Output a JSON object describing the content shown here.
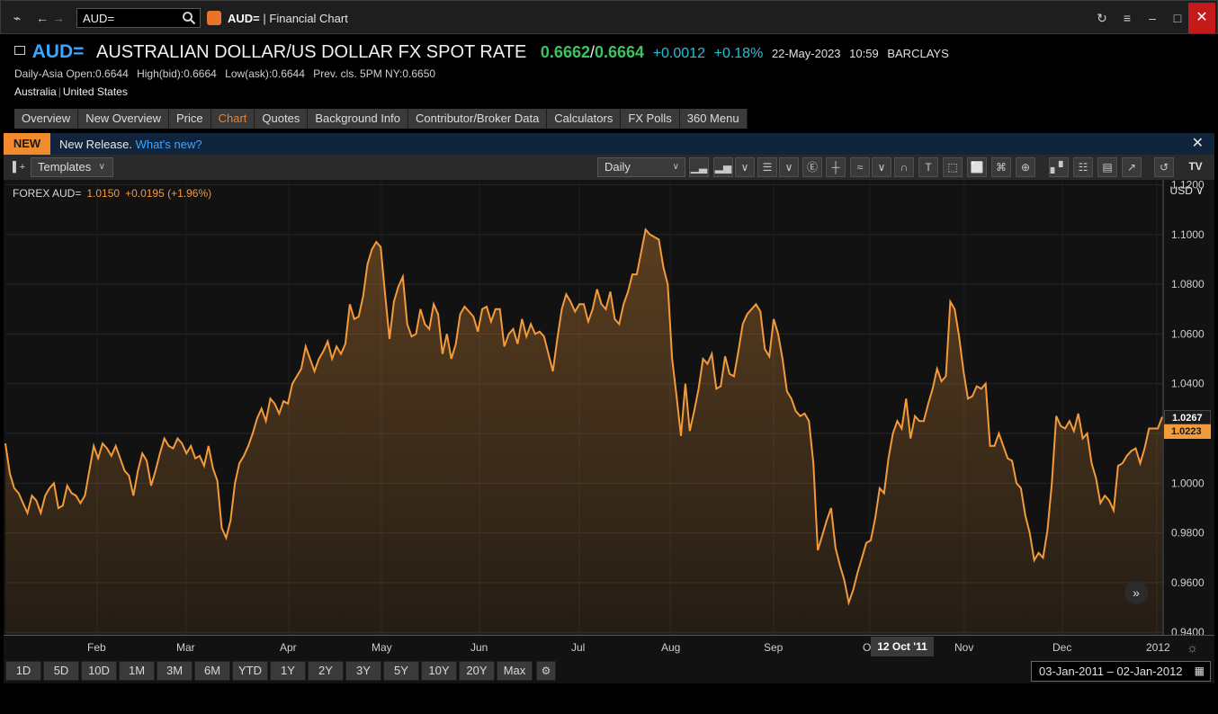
{
  "app": {
    "search_value": "AUD=",
    "title_ric": "AUD=",
    "title_sep": "|",
    "title_app": "Financial Chart"
  },
  "quote": {
    "ric": "AUD=",
    "name": "AUSTRALIAN DOLLAR/US DOLLAR FX SPOT RATE",
    "bid": "0.6662",
    "ask": "0.6664",
    "change": "+0.0012",
    "pct_change": "+0.18%",
    "date": "22-May-2023",
    "time": "10:59",
    "contributor": "BARCLAYS",
    "stats": {
      "open": "Daily-Asia Open:0.6644",
      "high": "High(bid):0.6664",
      "low": "Low(ask):0.6644",
      "prev": "Prev. cls. 5PM NY:0.6650"
    },
    "country_1": "Australia",
    "country_2": "United States"
  },
  "tabs": [
    "Overview",
    "New Overview",
    "Price",
    "Chart",
    "Quotes",
    "Background Info",
    "Contributor/Broker Data",
    "Calculators",
    "FX Polls",
    "360 Menu"
  ],
  "active_tab": "Chart",
  "banner": {
    "badge": "NEW",
    "text": "New Release.",
    "link": "What's new?"
  },
  "toolbar": {
    "templates": "Templates",
    "interval": "Daily"
  },
  "legend": {
    "label": "FOREX AUD=",
    "value": "1.0150",
    "change": "+0.0195 (+1.96%)"
  },
  "chart_data": {
    "type": "area",
    "currency_label": "USD",
    "y_ticks": [
      "1.1200",
      "1.1000",
      "1.0800",
      "1.0600",
      "1.0400",
      "1.0200",
      "1.0000",
      "0.9800",
      "0.9600",
      "0.9400"
    ],
    "ylim": [
      0.939,
      1.122
    ],
    "x_ticks": [
      "Feb",
      "Mar",
      "Apr",
      "May",
      "Jun",
      "Jul",
      "Aug",
      "Sep",
      "Oct",
      "Nov",
      "Dec",
      "2012"
    ],
    "last_value": "1.0267",
    "current_value": "1.0223",
    "crosshair_date": "12 Oct '11",
    "series": [
      {
        "values": [
          1.016,
          1.004,
          0.998,
          0.996,
          0.992,
          0.988,
          0.995,
          0.993,
          0.988,
          0.995,
          0.998,
          1.0,
          0.99,
          0.991,
          0.999,
          0.996,
          0.995,
          0.992,
          0.995,
          1.005,
          1.015,
          1.01,
          1.016,
          1.014,
          1.011,
          1.015,
          1.01,
          1.005,
          1.003,
          0.995,
          1.005,
          1.012,
          1.009,
          0.999,
          1.005,
          1.012,
          1.018,
          1.015,
          1.014,
          1.018,
          1.016,
          1.012,
          1.015,
          1.01,
          1.011,
          1.007,
          1.015,
          1.006,
          1.001,
          0.982,
          0.978,
          0.985,
          1.0,
          1.008,
          1.011,
          1.015,
          1.02,
          1.026,
          1.03,
          1.025,
          1.034,
          1.032,
          1.028,
          1.033,
          1.032,
          1.04,
          1.043,
          1.046,
          1.055,
          1.05,
          1.045,
          1.05,
          1.053,
          1.057,
          1.05,
          1.055,
          1.052,
          1.056,
          1.072,
          1.066,
          1.067,
          1.075,
          1.088,
          1.094,
          1.097,
          1.095,
          1.076,
          1.058,
          1.073,
          1.079,
          1.083,
          1.064,
          1.059,
          1.06,
          1.07,
          1.064,
          1.062,
          1.072,
          1.068,
          1.052,
          1.06,
          1.05,
          1.056,
          1.068,
          1.071,
          1.069,
          1.067,
          1.061,
          1.07,
          1.071,
          1.065,
          1.07,
          1.07,
          1.055,
          1.06,
          1.062,
          1.056,
          1.066,
          1.059,
          1.064,
          1.06,
          1.061,
          1.059,
          1.052,
          1.045,
          1.058,
          1.07,
          1.076,
          1.073,
          1.069,
          1.072,
          1.072,
          1.065,
          1.07,
          1.078,
          1.072,
          1.07,
          1.077,
          1.066,
          1.064,
          1.072,
          1.077,
          1.084,
          1.084,
          1.093,
          1.102,
          1.1,
          1.099,
          1.098,
          1.087,
          1.08,
          1.05,
          1.035,
          1.019,
          1.04,
          1.021,
          1.029,
          1.038,
          1.05,
          1.048,
          1.052,
          1.038,
          1.039,
          1.051,
          1.044,
          1.043,
          1.053,
          1.064,
          1.068,
          1.07,
          1.072,
          1.069,
          1.054,
          1.051,
          1.066,
          1.06,
          1.05,
          1.037,
          1.034,
          1.029,
          1.027,
          1.028,
          1.025,
          1.008,
          0.973,
          0.979,
          0.985,
          0.99,
          0.974,
          0.967,
          0.961,
          0.952,
          0.957,
          0.964,
          0.97,
          0.976,
          0.977,
          0.986,
          0.998,
          0.996,
          1.01,
          1.02,
          1.025,
          1.022,
          1.034,
          1.018,
          1.027,
          1.025,
          1.025,
          1.032,
          1.038,
          1.046,
          1.041,
          1.043,
          1.073,
          1.07,
          1.059,
          1.045,
          1.034,
          1.035,
          1.039,
          1.038,
          1.04,
          1.015,
          1.015,
          1.02,
          1.015,
          1.01,
          1.009,
          1.0,
          0.998,
          0.987,
          0.98,
          0.969,
          0.972,
          0.97,
          0.981,
          1.0,
          1.027,
          1.023,
          1.022,
          1.025,
          1.021,
          1.028,
          1.018,
          1.02,
          1.008,
          1.002,
          0.992,
          0.995,
          0.993,
          0.989,
          1.007,
          1.008,
          1.011,
          1.013,
          1.014,
          1.008,
          1.014,
          1.022,
          1.022,
          1.022,
          1.0267
        ]
      }
    ],
    "area_color": "#f39a3b"
  },
  "range_buttons": [
    "1D",
    "5D",
    "10D",
    "1M",
    "3M",
    "6M",
    "YTD",
    "1Y",
    "2Y",
    "3Y",
    "5Y",
    "10Y",
    "20Y",
    "Max"
  ],
  "date_range": {
    "start": "03-Jan-2011",
    "sep": "–",
    "end": "02-Jan-2012"
  }
}
